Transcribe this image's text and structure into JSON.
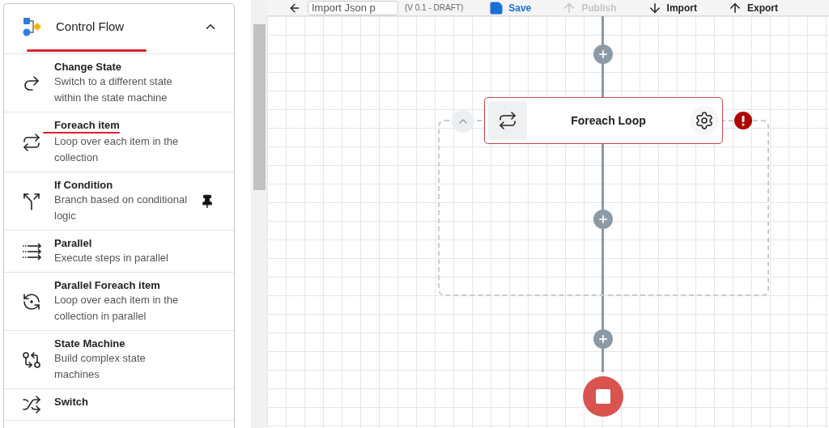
{
  "panel": {
    "title": "Control Flow",
    "expanded": true,
    "items": [
      {
        "kind": "change_state",
        "title": "Change State",
        "description": "Switch to a different state within the state machine",
        "pinned": false
      },
      {
        "kind": "foreach",
        "title": "Foreach item",
        "description": "Loop over each item in the collection",
        "pinned": false
      },
      {
        "kind": "if",
        "title": "If Condition",
        "description": "Branch based on conditional logic",
        "pinned": true
      },
      {
        "kind": "parallel",
        "title": "Parallel",
        "description": "Execute steps in parallel",
        "pinned": false
      },
      {
        "kind": "parallel_foreach",
        "title": "Parallel Foreach item",
        "description": "Loop over each item in the collection in parallel",
        "pinned": false
      },
      {
        "kind": "state_machine",
        "title": "State Machine",
        "description": "Build complex state machines",
        "pinned": false
      },
      {
        "kind": "switch",
        "title": "Switch"
      }
    ]
  },
  "toolbar": {
    "name_field": "Import Json p",
    "version": "(V 0.1 - DRAFT)",
    "buttons": [
      {
        "kind": "save",
        "label": "Save",
        "disabled": false
      },
      {
        "kind": "publish",
        "label": "Publish",
        "disabled": true
      },
      {
        "kind": "import",
        "label": "Import",
        "disabled": false
      },
      {
        "kind": "export",
        "label": "Export",
        "disabled": false
      }
    ]
  },
  "canvas": {
    "node": {
      "title": "Foreach Loop",
      "error": true
    },
    "group_expanded": true
  }
}
